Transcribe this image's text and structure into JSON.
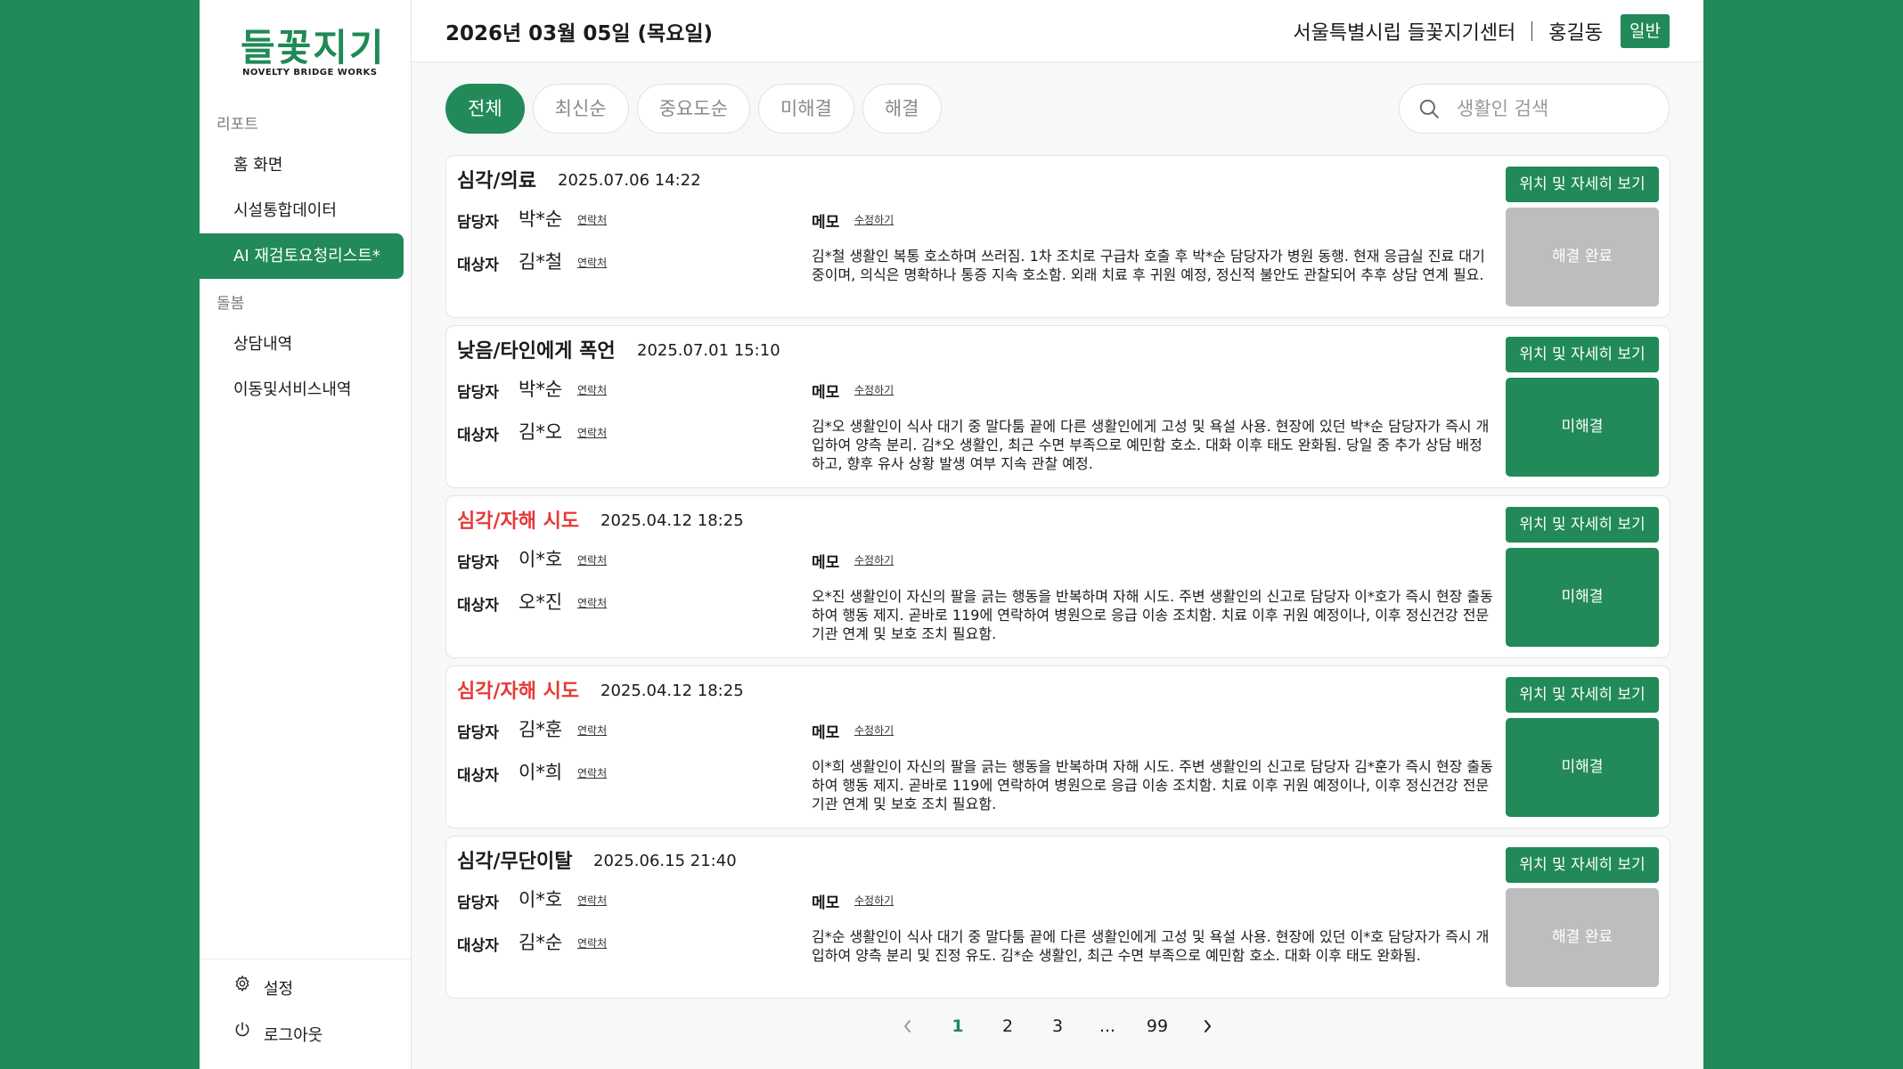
{
  "app": {
    "logo_text": "들꽃지기",
    "logo_sub": "NOVELTY BRIDGE WORKS"
  },
  "sidebar": {
    "section_report": "리포트",
    "items_report": [
      {
        "label": "홈 화면"
      },
      {
        "label": "시설통합데이터"
      },
      {
        "label": "AI 재검토요청리스트*"
      }
    ],
    "section_care": "돌봄",
    "items_care": [
      {
        "label": "상담내역"
      },
      {
        "label": "이동및서비스내역"
      }
    ],
    "settings_label": "설정",
    "logout_label": "로그아웃"
  },
  "header": {
    "date": "2026년 03월 05일 (목요일)",
    "center": "서울특별시립 들꽃지기센터",
    "user": "홍길동",
    "role": "일반"
  },
  "filters": {
    "chips": [
      {
        "label": "전체"
      },
      {
        "label": "최신순"
      },
      {
        "label": "중요도순"
      },
      {
        "label": "미해결"
      },
      {
        "label": "해결"
      }
    ],
    "search_placeholder": "생활인 검색"
  },
  "labels": {
    "manager": "담당자",
    "target": "대상자",
    "contact": "연락처",
    "memo": "메모",
    "edit": "수정하기",
    "location_btn": "위치 및 자세히 보기"
  },
  "cards": [
    {
      "title": "심각/의료",
      "date": "2025.07.06 14:22",
      "manager": "박*순",
      "target": "김*철",
      "memo": "김*철 생활인 복통 호소하며 쓰러짐.  1차 조치로 구급차 호출 후 박*순 담당자가 병원 동행. 현재 응급실 진료 대기 중이며, 의식은 명확하나 통증 지속 호소함.  외래 치료 후 귀원 예정, 정신적 불안도 관찰되어 추후 상담 연계 필요.",
      "status": "해결 완료"
    },
    {
      "title": "낮음/타인에게 폭언",
      "date": "2025.07.01 15:10",
      "manager": "박*순",
      "target": "김*오",
      "memo": "김*오 생활인이 식사 대기 중 말다툼 끝에 다른 생활인에게 고성 및 욕설 사용. 현장에 있던 박*순 담당자가 즉시 개입하여 양측 분리. 김*오 생활인, 최근 수면 부족으로 예민함 호소. 대화 이후 태도 완화됨. 당일 중 추가 상담 배정하고, 향후 유사 상황 발생 여부 지속 관찰 예정.",
      "status": "미해결"
    },
    {
      "title": "심각/자해 시도",
      "date": "2025.04.12 18:25",
      "manager": "이*호",
      "target": "오*진",
      "memo": "오*진 생활인이 자신의 팔을 긁는 행동을 반복하며 자해 시도. 주변 생활인의 신고로 담당자 이*호가 즉시 현장 출동하여 행동 제지. 곧바로 119에 연락하여 병원으로 응급 이송 조치함. 치료 이후 귀원 예정이나, 이후 정신건강 전문기관 연계 및 보호 조치 필요함.",
      "status": "미해결"
    },
    {
      "title": "심각/자해 시도",
      "date": "2025.04.12 18:25",
      "manager": "김*훈",
      "target": "이*희",
      "memo": "이*희 생활인이 자신의 팔을 긁는 행동을 반복하며 자해 시도. 주변 생활인의 신고로 담당자 김*훈가 즉시 현장 출동하여 행동 제지. 곧바로 119에 연락하여 병원으로 응급 이송 조치함. 치료 이후 귀원 예정이나, 이후 정신건강 전문기관 연계 및 보호 조치 필요함.",
      "status": "미해결"
    },
    {
      "title": "심각/무단이탈",
      "date": "2025.06.15 21:40",
      "manager": "이*호",
      "target": "김*순",
      "memo": "김*순 생활인이 식사 대기 중 말다툼 끝에 다른 생활인에게 고성 및 욕설 사용. 현장에 있던 이*호 담당자가 즉시 개입하여 양측 분리 및 진정 유도. 김*순 생활인, 최근 수면 부족으로 예민함 호소. 대화 이후 태도 완화됨.",
      "status": "해결 완료"
    }
  ],
  "pagination": {
    "pages": [
      "1",
      "2",
      "3",
      "...",
      "99"
    ],
    "current": "1"
  },
  "colors": {
    "brand": "#218a58",
    "danger": "#e53935",
    "resolved": "#bdbdbd"
  },
  "icons": {
    "search": "search-icon",
    "settings": "gear-icon",
    "logout": "power-icon",
    "prev": "chevron-left-icon",
    "next": "chevron-right-icon"
  }
}
